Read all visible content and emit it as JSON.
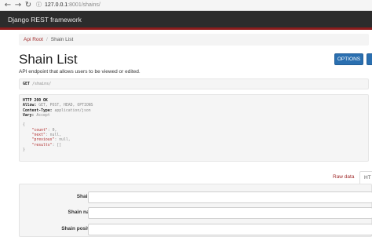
{
  "browser": {
    "url_host": "127.0.0.1",
    "url_path": ":8001/shains/"
  },
  "navbar": {
    "brand": "Django REST framework"
  },
  "breadcrumb": {
    "root": "Api Root",
    "separator": "/",
    "current": "Shain List"
  },
  "page": {
    "title": "Shain List",
    "description": "API endpoint that allows users to be viewed or edited."
  },
  "actions": {
    "options_label": "OPTIONS"
  },
  "request": {
    "method": "GET",
    "path": "/shains/"
  },
  "response": {
    "status": "HTTP 200 OK",
    "headers": [
      {
        "name": "Allow:",
        "value": "GET, POST, HEAD, OPTIONS"
      },
      {
        "name": "Content-Type:",
        "value": "application/json"
      },
      {
        "name": "Vary:",
        "value": "Accept"
      }
    ],
    "body_open": "{",
    "fields": [
      {
        "key": "\"count\"",
        "value": "0,"
      },
      {
        "key": "\"next\"",
        "value": "null,"
      },
      {
        "key": "\"previous\"",
        "value": "null,"
      },
      {
        "key": "\"results\"",
        "value": "[]"
      }
    ],
    "body_close": "}"
  },
  "tabs": {
    "raw": "Raw data",
    "html": "HT"
  },
  "form": {
    "fields": [
      {
        "label": "Shain id"
      },
      {
        "label": "Shain name"
      },
      {
        "label": "Shain position"
      }
    ]
  }
}
